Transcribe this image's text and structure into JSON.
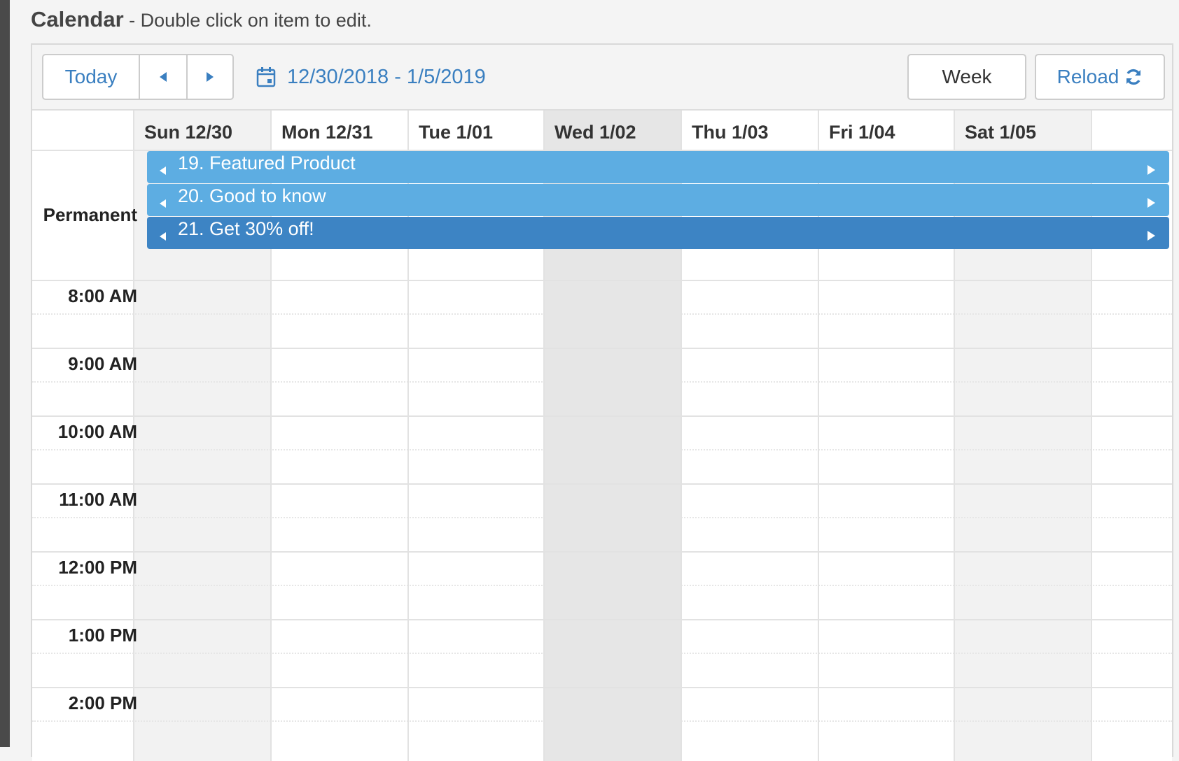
{
  "header": {
    "title": "Calendar",
    "subtitle": " - Double click on item to edit."
  },
  "toolbar": {
    "today_label": "Today",
    "prev_icon": "triangle-left",
    "next_icon": "triangle-right",
    "date_range": "12/30/2018 - 1/5/2019",
    "view_label": "Week",
    "reload_label": "Reload"
  },
  "calendar": {
    "days": [
      {
        "label": "Sun 12/30",
        "weekend": true,
        "today": false
      },
      {
        "label": "Mon 12/31",
        "weekend": false,
        "today": false
      },
      {
        "label": "Tue 1/01",
        "weekend": false,
        "today": false
      },
      {
        "label": "Wed 1/02",
        "weekend": false,
        "today": true
      },
      {
        "label": "Thu 1/03",
        "weekend": false,
        "today": false
      },
      {
        "label": "Fri 1/04",
        "weekend": false,
        "today": false
      },
      {
        "label": "Sat 1/05",
        "weekend": true,
        "today": false
      }
    ],
    "permanent_label": "Permanent",
    "events": [
      {
        "title": "19. Featured Product",
        "color": "#5dade2"
      },
      {
        "title": "20. Good to know",
        "color": "#5dade2"
      },
      {
        "title": "21. Get 30% off!",
        "color": "#3d84c4"
      }
    ],
    "times": [
      "8:00 AM",
      "9:00 AM",
      "10:00 AM",
      "11:00 AM",
      "12:00 PM",
      "1:00 PM",
      "2:00 PM"
    ]
  },
  "colors": {
    "accent": "#3a7fc0",
    "weekend_bg": "#f2f2f2",
    "today_bg": "#e6e6e6"
  }
}
